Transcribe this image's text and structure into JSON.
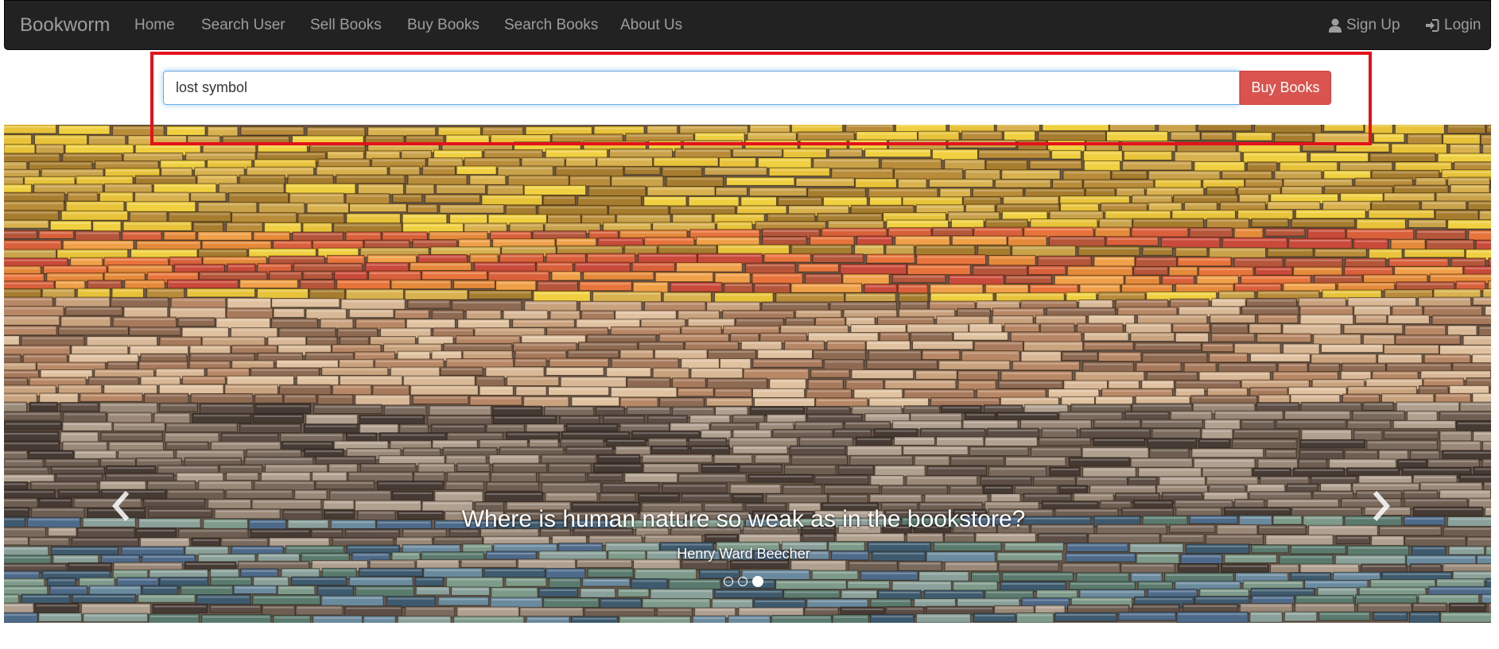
{
  "navbar": {
    "brand": "Bookworm",
    "links": [
      "Home",
      "Search User",
      "Sell Books",
      "Buy Books",
      "Search Books",
      "About Us"
    ],
    "signup": "Sign Up",
    "login": "Login"
  },
  "search": {
    "value": "lost symbol",
    "button_label": "Buy Books"
  },
  "carousel": {
    "quote": "Where is human nature so weak as in the bookstore?",
    "author": "Henry Ward Beecher",
    "slide_count": 3,
    "active_slide": 3,
    "prev_icon": "chevron-left-icon",
    "next_icon": "chevron-right-icon"
  },
  "colors": {
    "navbar_bg": "#222222",
    "nav_text": "#9d9d9d",
    "button_red": "#d9534f",
    "highlight": "#e3121b"
  }
}
